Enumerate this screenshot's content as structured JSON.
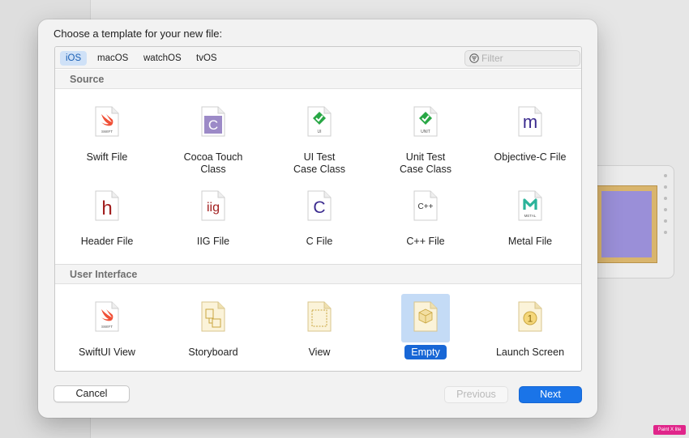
{
  "dialog": {
    "title": "Choose a template for your new file:"
  },
  "tabs": [
    {
      "label": "iOS",
      "selected": true
    },
    {
      "label": "macOS",
      "selected": false
    },
    {
      "label": "watchOS",
      "selected": false
    },
    {
      "label": "tvOS",
      "selected": false
    }
  ],
  "filter": {
    "placeholder": "Filter",
    "value": ""
  },
  "sections": [
    {
      "header": "Source",
      "items": [
        {
          "label": "Swift File",
          "icon": "swift-file-icon"
        },
        {
          "label": "Cocoa Touch\nClass",
          "icon": "cocoa-touch-class-icon"
        },
        {
          "label": "UI Test\nCase Class",
          "icon": "ui-test-case-class-icon"
        },
        {
          "label": "Unit Test\nCase Class",
          "icon": "unit-test-case-class-icon"
        },
        {
          "label": "Objective-C File",
          "icon": "objective-c-file-icon"
        },
        {
          "label": "Header File",
          "icon": "header-file-icon"
        },
        {
          "label": "IIG File",
          "icon": "iig-file-icon"
        },
        {
          "label": "C File",
          "icon": "c-file-icon"
        },
        {
          "label": "C++ File",
          "icon": "cpp-file-icon"
        },
        {
          "label": "Metal File",
          "icon": "metal-file-icon"
        }
      ]
    },
    {
      "header": "User Interface",
      "items": [
        {
          "label": "SwiftUI View",
          "icon": "swiftui-view-icon"
        },
        {
          "label": "Storyboard",
          "icon": "storyboard-icon"
        },
        {
          "label": "View",
          "icon": "view-icon"
        },
        {
          "label": "Empty",
          "icon": "empty-icon",
          "selected": true
        },
        {
          "label": "Launch Screen",
          "icon": "launch-screen-icon"
        }
      ]
    }
  ],
  "icon_glyphs": {
    "swift": "SWIFT",
    "cocoa": "C",
    "ui_test": "UI",
    "unit_test": "UNIT",
    "objc": "m",
    "header": "h",
    "iig": "iig",
    "c": "C",
    "cpp": "C++",
    "metal": "METAL",
    "swiftui": "SWIFT",
    "launch": "1"
  },
  "buttons": {
    "cancel": "Cancel",
    "previous": "Previous",
    "next": "Next"
  },
  "colors": {
    "accent": "#1a74e8",
    "selection": "#c4dbf6",
    "swift_orange": "#f05138",
    "objc_purple": "#3b2b8f",
    "header_red": "#a11d1d",
    "test_green": "#28a745"
  },
  "watermark": "Paint X lite"
}
